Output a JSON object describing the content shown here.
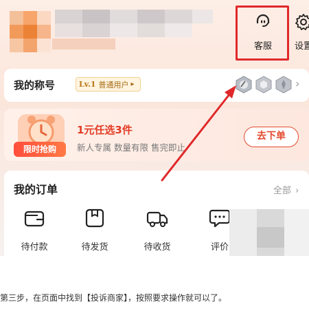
{
  "header": {
    "customer_service_label": "客服",
    "settings_label": "设置"
  },
  "title_section": {
    "label": "我的称号",
    "level_badge": "Lv.1",
    "level_text": "普通用户"
  },
  "promo": {
    "title": "1元任选3件",
    "subtitle": "新人专属  数量有限  售完即止",
    "tag": "限时抢购",
    "button": "去下单"
  },
  "orders": {
    "title": "我的订单",
    "all_label": "全部",
    "items": [
      {
        "label": "待付款",
        "icon": "wallet-icon"
      },
      {
        "label": "待发货",
        "icon": "package-icon"
      },
      {
        "label": "待收货",
        "icon": "truck-icon"
      },
      {
        "label": "评价",
        "icon": "comment-icon"
      }
    ]
  },
  "caption": "第三步，在页面中找到【投诉商家】，按照要求操作就可以了。",
  "colors": {
    "highlight_red": "#e0282a",
    "promo_red": "#e23c25",
    "badge_gold": "#b77718"
  }
}
